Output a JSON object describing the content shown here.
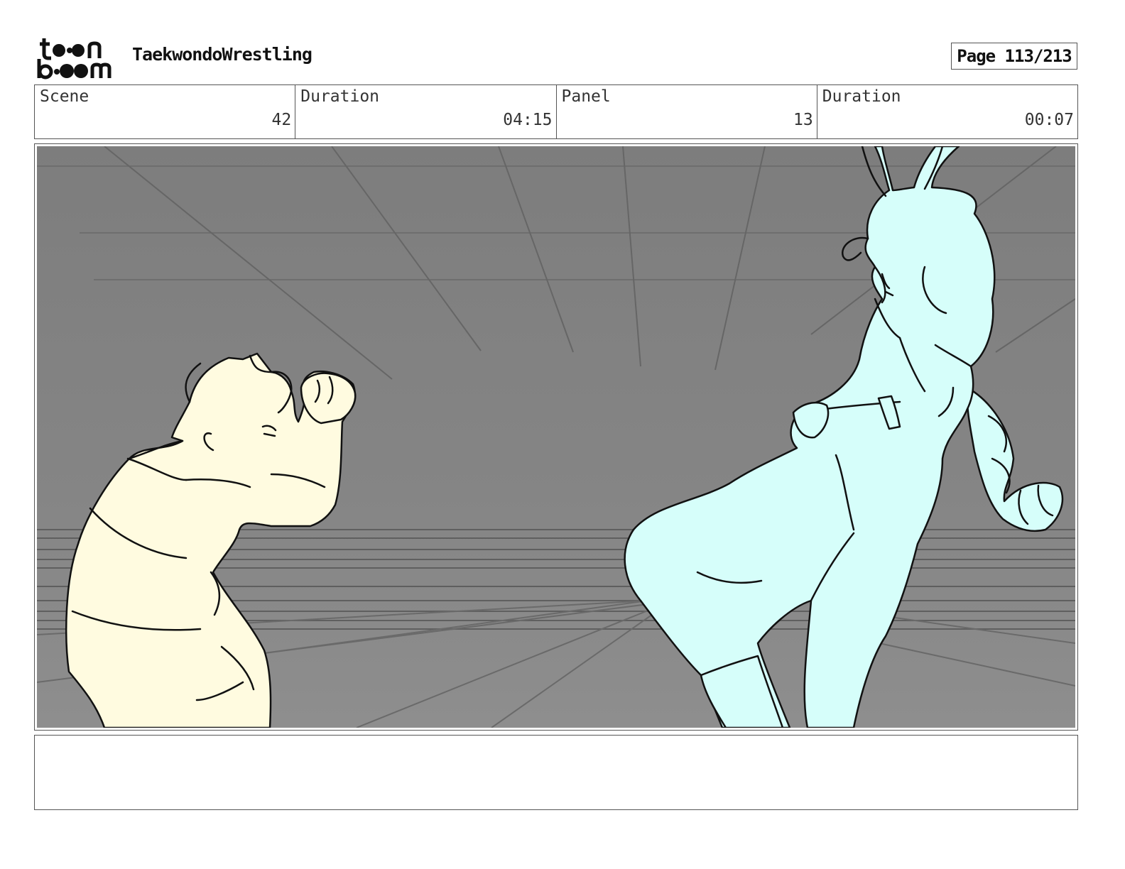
{
  "header": {
    "logo_text": "toon boom",
    "project_title": "TaekwondoWrestling",
    "page_label": "Page 113/213"
  },
  "info": {
    "scene_label": "Scene",
    "scene_value": "42",
    "scene_duration_label": "Duration",
    "scene_duration_value": "04:15",
    "panel_label": "Panel",
    "panel_value": "13",
    "panel_duration_label": "Duration",
    "panel_duration_value": "00:07"
  },
  "notes": {
    "text": ""
  },
  "colors": {
    "background_gray": "#8a8a8a",
    "left_character_fill": "#fffbe0",
    "right_character_fill": "#d6fefa",
    "line": "#111111"
  }
}
